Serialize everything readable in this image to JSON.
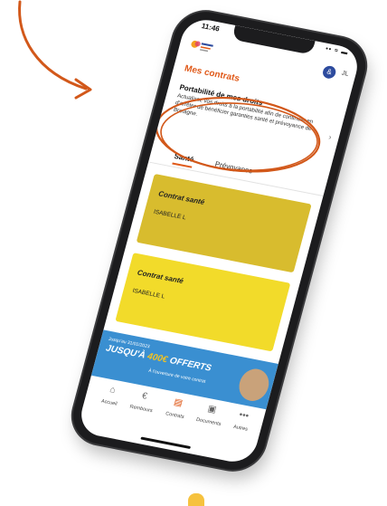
{
  "colors": {
    "accent": "#e05a1a",
    "card_dark": "#d8bc2e",
    "card_light": "#f2db2a",
    "banner": "#3a8fd1",
    "avatar": "#2d4b9e"
  },
  "status": {
    "time": "11:46",
    "icons": "•• ≈ ▬"
  },
  "header": {
    "avatar_letter": "&",
    "initial": "JL"
  },
  "page": {
    "title": "Mes contrats"
  },
  "portability": {
    "title": "Portabilité de mes droits",
    "text": "Actualisez vos droits à la portabilité afin de continuer en d'arrêter de bénéficier garanties santé et prévoyance de Bretagne."
  },
  "tabs": [
    {
      "label": "Santé"
    },
    {
      "label": "Prévoyance"
    }
  ],
  "cards": [
    {
      "title": "Contrat santé",
      "name": "ISABELLE L"
    },
    {
      "title": "Contrat santé",
      "name": "ISABELLE L"
    }
  ],
  "banner": {
    "line1": "Jusqu'au 31/01/2023",
    "line2_prefix": "JUSQU'À ",
    "amount": "400€",
    "line2_suffix": " OFFERTS",
    "line3": "À l'ouverture de votre contrat"
  },
  "nav": [
    {
      "label": "Accueil",
      "icon": "home-icon",
      "glyph": "⌂"
    },
    {
      "label": "Rembours",
      "icon": "euro-icon",
      "glyph": "€"
    },
    {
      "label": "Contrats",
      "icon": "document-icon",
      "glyph": "▤"
    },
    {
      "label": "Documents",
      "icon": "folder-icon",
      "glyph": "▣"
    },
    {
      "label": "Autres",
      "icon": "more-icon",
      "glyph": "•••"
    }
  ]
}
